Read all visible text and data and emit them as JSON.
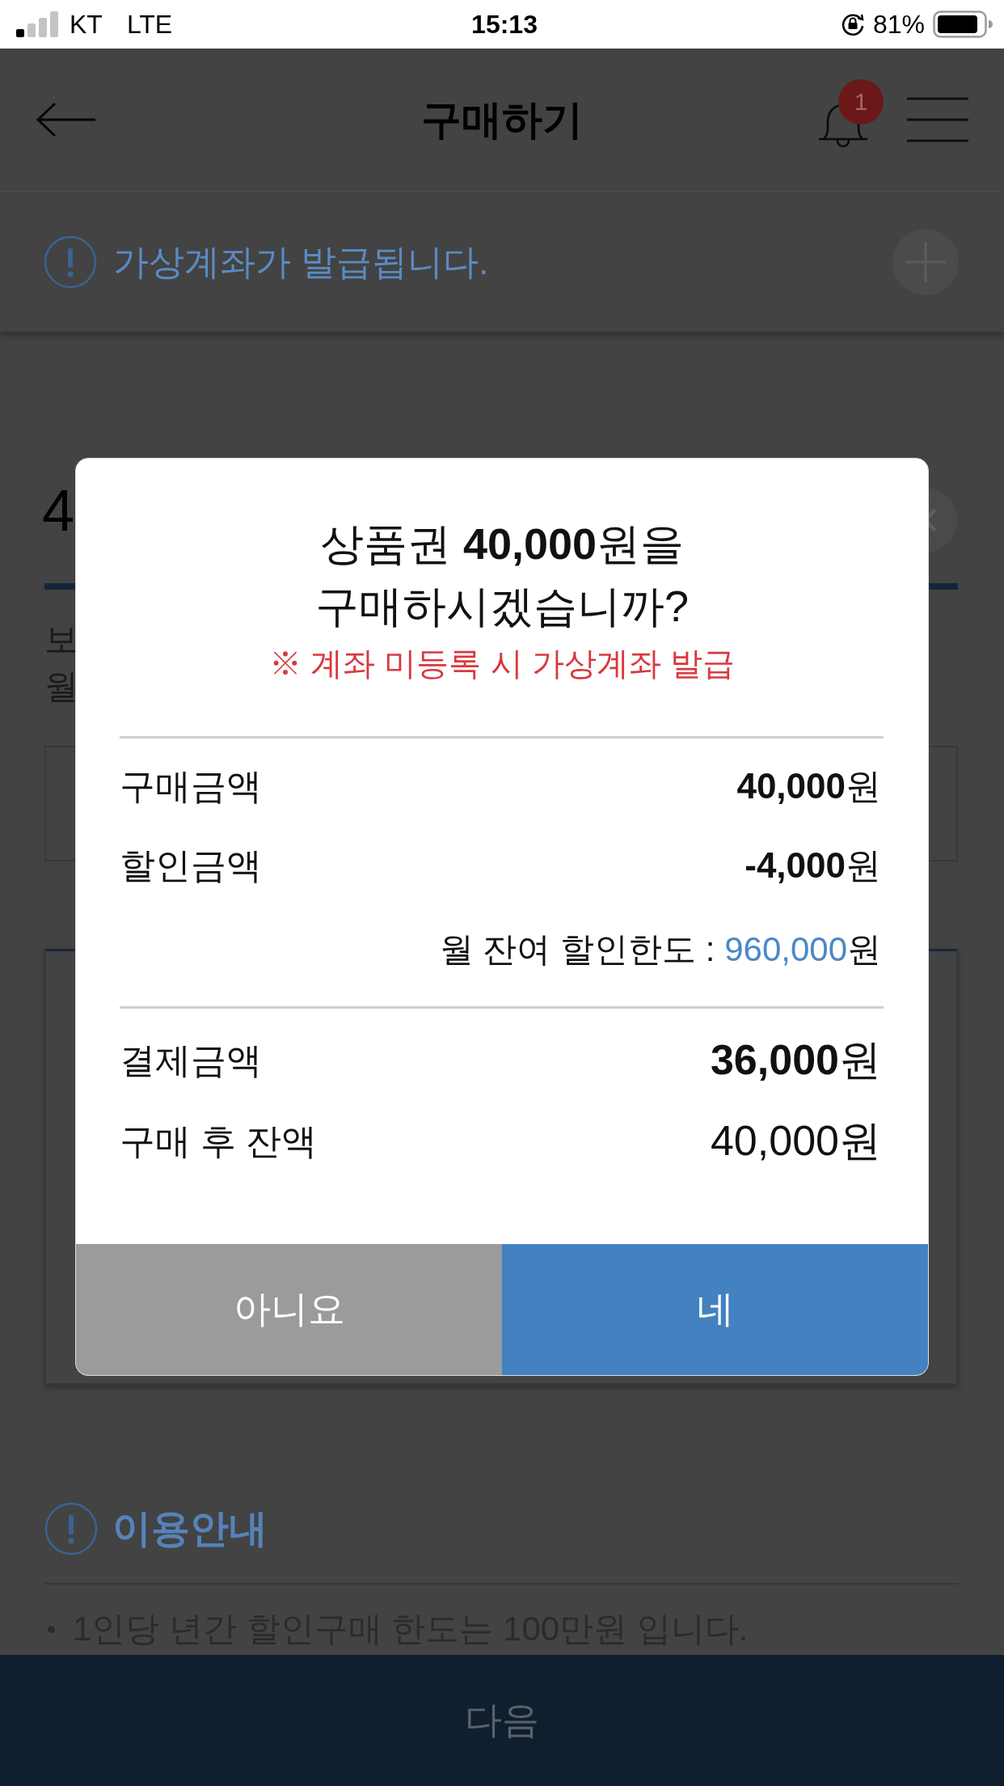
{
  "status_bar": {
    "carrier": "KT",
    "network": "LTE",
    "time": "15:13",
    "battery": "81%"
  },
  "header": {
    "title": "구매하기",
    "notification_count": "1"
  },
  "notice": {
    "text": "가상계좌가 발급됩니다."
  },
  "background": {
    "amount_fragment": "4",
    "lines": [
      "보",
      "월"
    ]
  },
  "guide": {
    "title": "이용안내",
    "items": [
      "1인당 년간 할인구매 한도는 100만원 입니다."
    ]
  },
  "next_button": "다음",
  "dialog": {
    "title_lines": [
      "상품권 **40,000**원을",
      "구매하시겠습니까?"
    ],
    "warning": "※ 계좌 미등록 시 가상계좌 발급",
    "rows": [
      {
        "kind": "item",
        "label": "구매금액",
        "value": "**40,000**원"
      },
      {
        "kind": "item",
        "label": "할인금액",
        "value": "**-4,000**원"
      }
    ],
    "limit": {
      "label": "월 잔여 할인한도 :",
      "amount": "960,000",
      "unit": "원"
    },
    "totals": [
      {
        "kind": "total",
        "label": "결제금액",
        "value": "**36,000**원"
      },
      {
        "kind": "total",
        "label": "구매 후 잔액",
        "value": "40,000원"
      }
    ],
    "buttons": [
      {
        "kind": "cancel",
        "label": "아니요"
      },
      {
        "kind": "confirm",
        "label": "네"
      }
    ]
  }
}
